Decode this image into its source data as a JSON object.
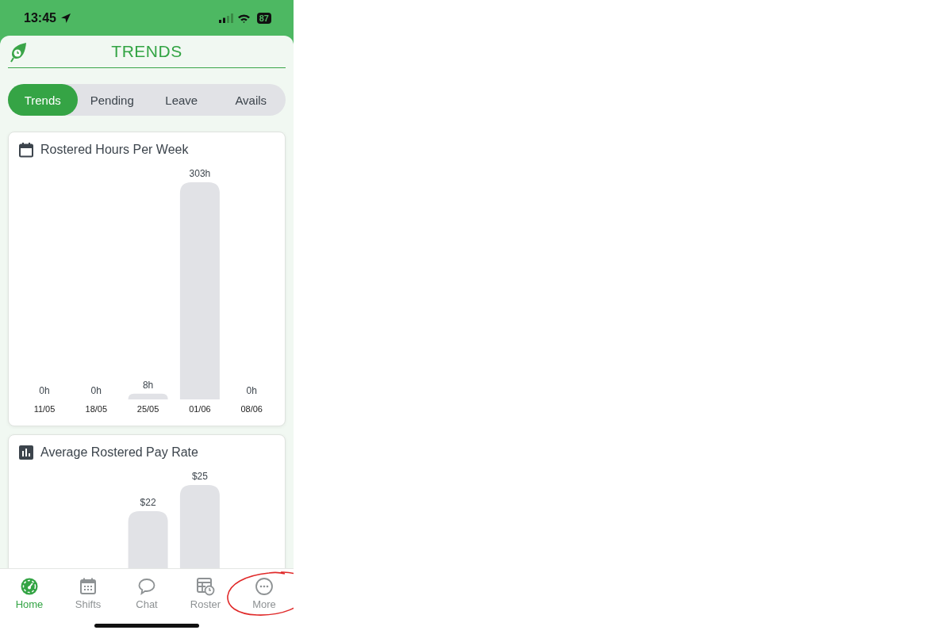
{
  "status_bar": {
    "time": "13:45",
    "battery": "87"
  },
  "header": {
    "title": "TRENDS"
  },
  "tabs": [
    {
      "label": "Trends",
      "selected": true
    },
    {
      "label": "Pending",
      "selected": false
    },
    {
      "label": "Leave",
      "selected": false
    },
    {
      "label": "Avails",
      "selected": false
    }
  ],
  "cards": [
    {
      "kind": "calendar",
      "title": "Rostered Hours Per Week",
      "chart_data": {
        "type": "bar",
        "categories": [
          "11/05",
          "18/05",
          "25/05",
          "01/06",
          "08/06"
        ],
        "values": [
          0,
          0,
          8,
          303,
          0
        ],
        "value_labels": [
          "0h",
          "0h",
          "8h",
          "303h",
          "0h"
        ]
      }
    },
    {
      "kind": "bars",
      "title": "Average Rostered Pay Rate",
      "chart_data": {
        "type": "bar",
        "values": [
          null,
          null,
          22,
          25,
          null
        ],
        "value_labels": [
          null,
          null,
          "$22",
          "$25",
          null
        ]
      }
    }
  ],
  "nav": [
    {
      "kind": "home",
      "label": "Home",
      "selected": true
    },
    {
      "kind": "shifts",
      "label": "Shifts",
      "selected": false
    },
    {
      "kind": "chat",
      "label": "Chat",
      "selected": false
    },
    {
      "kind": "roster",
      "label": "Roster",
      "selected": false
    },
    {
      "kind": "more",
      "label": "More",
      "selected": false
    }
  ]
}
